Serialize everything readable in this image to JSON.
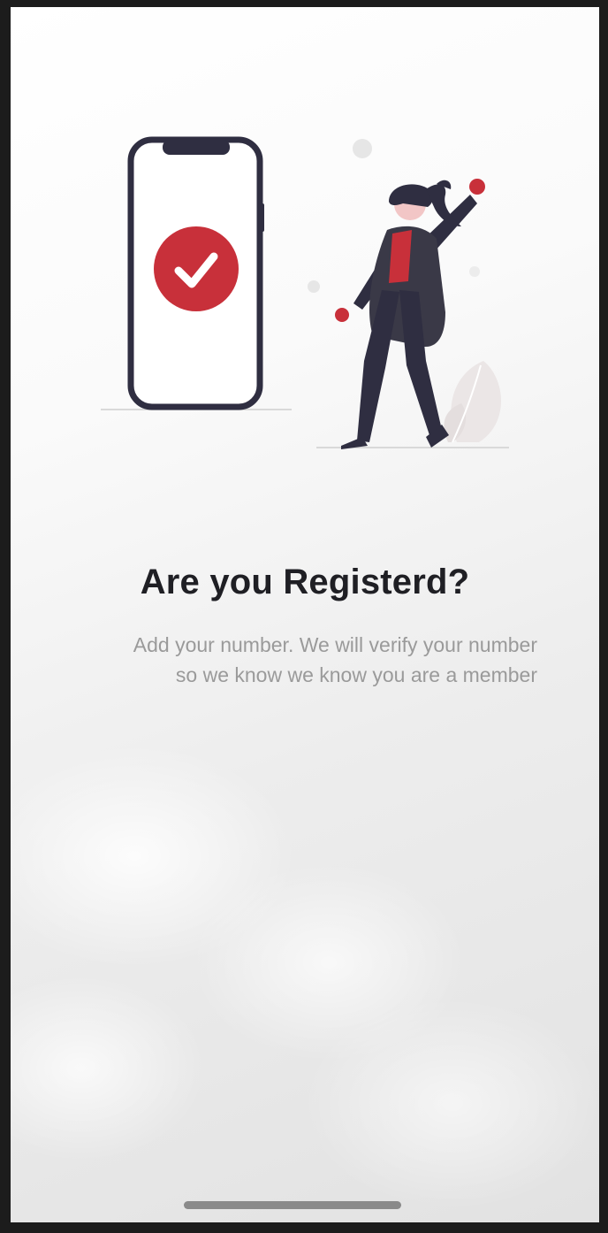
{
  "onboarding": {
    "title": "Are you Registerd?",
    "subtitle_line1": "Add your number. We will verify your number",
    "subtitle_line2": "so we know  we know you are a  member"
  },
  "illustration": {
    "phone_icon": "smartphone-icon",
    "check_icon": "checkmark-icon",
    "person": "celebrating-woman-illustration",
    "accent_color": "#c8303a",
    "dark_color": "#2f2e41"
  },
  "system": {
    "home_indicator": "home-indicator"
  }
}
